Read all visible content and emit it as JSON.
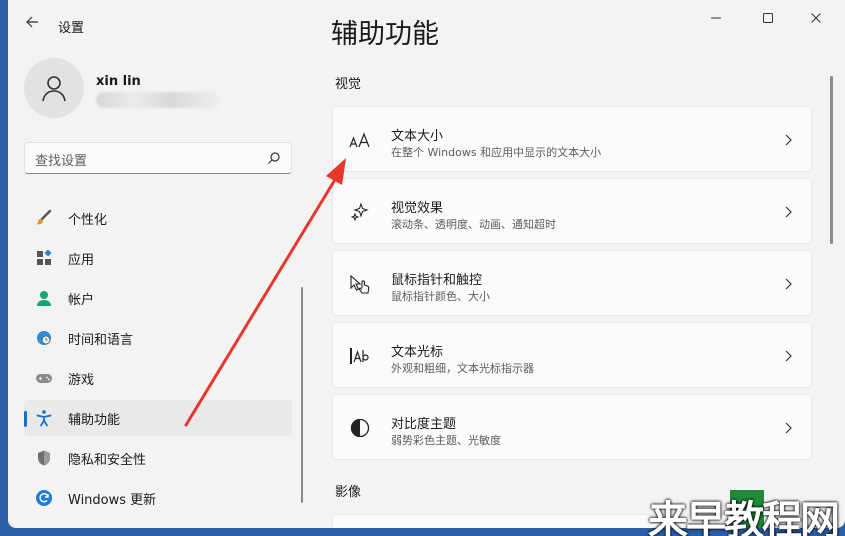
{
  "window": {
    "title": "设置"
  },
  "profile": {
    "name": "xin lin"
  },
  "search": {
    "placeholder": "查找设置"
  },
  "nav": {
    "items": [
      {
        "label": "个性化",
        "icon": "brush-icon"
      },
      {
        "label": "应用",
        "icon": "apps-icon"
      },
      {
        "label": "帐户",
        "icon": "account-icon"
      },
      {
        "label": "时间和语言",
        "icon": "globe-clock-icon"
      },
      {
        "label": "游戏",
        "icon": "gamepad-icon"
      },
      {
        "label": "辅助功能",
        "icon": "accessibility-icon",
        "active": true
      },
      {
        "label": "隐私和安全性",
        "icon": "shield-icon"
      },
      {
        "label": "Windows 更新",
        "icon": "update-icon"
      }
    ]
  },
  "main": {
    "title": "辅助功能",
    "sections": [
      {
        "label": "视觉",
        "cards": [
          {
            "title": "文本大小",
            "subtitle": "在整个 Windows 和应用中显示的文本大小",
            "icon": "text-size-icon"
          },
          {
            "title": "视觉效果",
            "subtitle": "滚动条、透明度、动画、通知超时",
            "icon": "sparkle-icon"
          },
          {
            "title": "鼠标指针和触控",
            "subtitle": "鼠标指针颜色、大小",
            "icon": "pointer-touch-icon"
          },
          {
            "title": "文本光标",
            "subtitle": "外观和粗细，文本光标指示器",
            "icon": "text-cursor-icon"
          },
          {
            "title": "对比度主题",
            "subtitle": "弱势彩色主题、光敏度",
            "icon": "contrast-icon"
          }
        ]
      },
      {
        "label": "影像",
        "cards": []
      }
    ]
  },
  "colors": {
    "accent": "#1a6fc9",
    "annotation_arrow": "#e8362f",
    "window_bg": "#f3f3f3",
    "card_bg": "#fbfbfb"
  },
  "watermark": {
    "text": "来早教程网"
  }
}
